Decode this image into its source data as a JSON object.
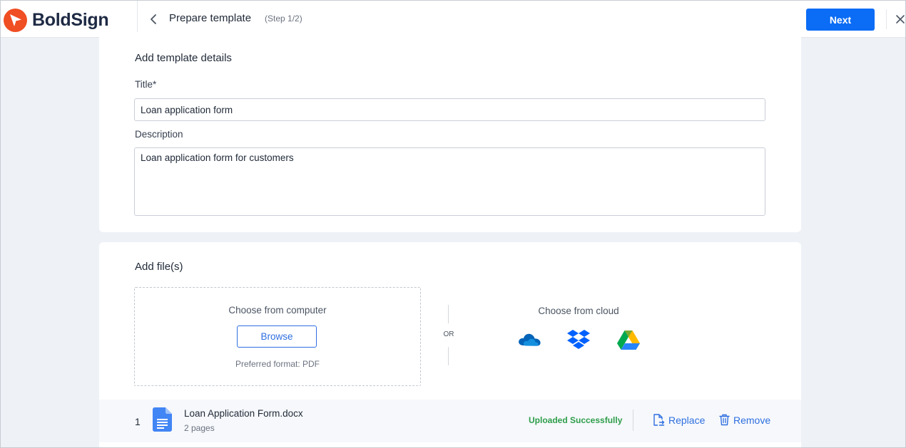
{
  "app": {
    "name": "BoldSign",
    "brand_color": "#f04e23"
  },
  "header": {
    "title": "Prepare template",
    "step": "(Step 1/2)",
    "next_label": "Next",
    "back_icon": "chevron-left-icon",
    "close_icon": "close-icon"
  },
  "details": {
    "section_title": "Add template details",
    "title_label": "Title*",
    "title_value": "Loan application form",
    "description_label": "Description",
    "description_value": "Loan application form for customers"
  },
  "files": {
    "section_title": "Add file(s)",
    "computer_title": "Choose from computer",
    "browse_label": "Browse",
    "preferred_format": "Preferred format: PDF",
    "or_label": "OR",
    "cloud_title": "Choose from cloud",
    "cloud_providers": [
      "onedrive-icon",
      "dropbox-icon",
      "google-drive-icon"
    ],
    "list": [
      {
        "index": "1",
        "name": "Loan Application Form.docx",
        "pages": "2 pages",
        "status": "Uploaded Successfully",
        "replace_label": "Replace",
        "remove_label": "Remove"
      }
    ]
  },
  "colors": {
    "primary": "#0b6cf5",
    "link": "#2f6fe0",
    "success": "#2e9d4a"
  }
}
